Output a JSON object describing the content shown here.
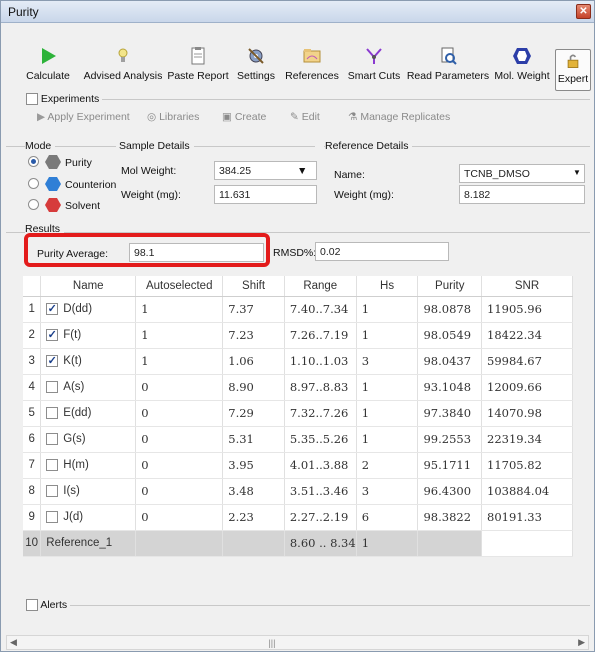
{
  "window": {
    "title": "Purity",
    "close_label": "✕"
  },
  "toolbar": [
    {
      "label": "Calculate",
      "icon": "play-icon"
    },
    {
      "label": "Advised Analysis",
      "icon": "lightbulb-icon"
    },
    {
      "label": "Paste Report",
      "icon": "clipboard-icon"
    },
    {
      "label": "Settings",
      "icon": "settings-icon"
    },
    {
      "label": "References",
      "icon": "folder-icon"
    },
    {
      "label": "Smart Cuts",
      "icon": "molecule-icon"
    },
    {
      "label": "Read Parameters",
      "icon": "read-params-icon"
    },
    {
      "label": "Mol. Weight",
      "icon": "hexagon-icon"
    },
    {
      "label": "Expert",
      "icon": "lock-icon"
    }
  ],
  "experiments": {
    "label": "Experiments",
    "actions": [
      "Apply Experiment",
      "Libraries",
      "Create",
      "Edit",
      "Manage Replicates"
    ]
  },
  "mode": {
    "label": "Mode",
    "options": [
      "Purity",
      "Counterion",
      "Solvent"
    ],
    "selected": "Purity"
  },
  "sample": {
    "label": "Sample Details",
    "mol_weight_label": "Mol Weight:",
    "mol_weight": "384.25",
    "weight_label": "Weight (mg):",
    "weight": "11.631"
  },
  "reference": {
    "label": "Reference Details",
    "name_label": "Name:",
    "name": "TCNB_DMSO",
    "weight_label": "Weight (mg):",
    "weight": "8.182"
  },
  "results": {
    "label": "Results",
    "purity_avg_label": "Purity Average:",
    "purity_avg": "98.1",
    "rmsd_label": "RMSD%:",
    "rmsd": "0.02"
  },
  "table": {
    "headers": [
      "Name",
      "Autoselected",
      "Shift",
      "Range",
      "Hs",
      "Purity",
      "SNR"
    ],
    "rows": [
      {
        "idx": "1",
        "checked": true,
        "name": "D(dd)",
        "auto": "1",
        "shift": "7.37",
        "range": "7.40..7.34",
        "hs": "1",
        "purity": "98.0878",
        "snr": "11905.96"
      },
      {
        "idx": "2",
        "checked": true,
        "name": "F(t)",
        "auto": "1",
        "shift": "7.23",
        "range": "7.26..7.19",
        "hs": "1",
        "purity": "98.0549",
        "snr": "18422.34"
      },
      {
        "idx": "3",
        "checked": true,
        "name": "K(t)",
        "auto": "1",
        "shift": "1.06",
        "range": "1.10..1.03",
        "hs": "3",
        "purity": "98.0437",
        "snr": "59984.67"
      },
      {
        "idx": "4",
        "checked": false,
        "name": "A(s)",
        "auto": "0",
        "shift": "8.90",
        "range": "8.97..8.83",
        "hs": "1",
        "purity": "93.1048",
        "snr": "12009.66"
      },
      {
        "idx": "5",
        "checked": false,
        "name": "E(dd)",
        "auto": "0",
        "shift": "7.29",
        "range": "7.32..7.26",
        "hs": "1",
        "purity": "97.3840",
        "snr": "14070.98"
      },
      {
        "idx": "6",
        "checked": false,
        "name": "G(s)",
        "auto": "0",
        "shift": "5.31",
        "range": "5.35..5.26",
        "hs": "1",
        "purity": "99.2553",
        "snr": "22319.34"
      },
      {
        "idx": "7",
        "checked": false,
        "name": "H(m)",
        "auto": "0",
        "shift": "3.95",
        "range": "4.01..3.88",
        "hs": "2",
        "purity": "95.1711",
        "snr": "11705.82"
      },
      {
        "idx": "8",
        "checked": false,
        "name": "I(s)",
        "auto": "0",
        "shift": "3.48",
        "range": "3.51..3.46",
        "hs": "3",
        "purity": "96.4300",
        "snr": "103884.04"
      },
      {
        "idx": "9",
        "checked": false,
        "name": "J(d)",
        "auto": "0",
        "shift": "2.23",
        "range": "2.27..2.19",
        "hs": "6",
        "purity": "98.3822",
        "snr": "80191.33"
      }
    ],
    "ref_row": {
      "idx": "10",
      "name": "Reference_1",
      "range": "8.60 .. 8.34",
      "hs": "1"
    }
  },
  "alerts": {
    "label": "Alerts"
  },
  "colors": {
    "highlight": "#e31b1b",
    "play": "#2db33a",
    "mode_hex": [
      "#7a7a7a",
      "#2f7fd6",
      "#d63b3b"
    ]
  }
}
